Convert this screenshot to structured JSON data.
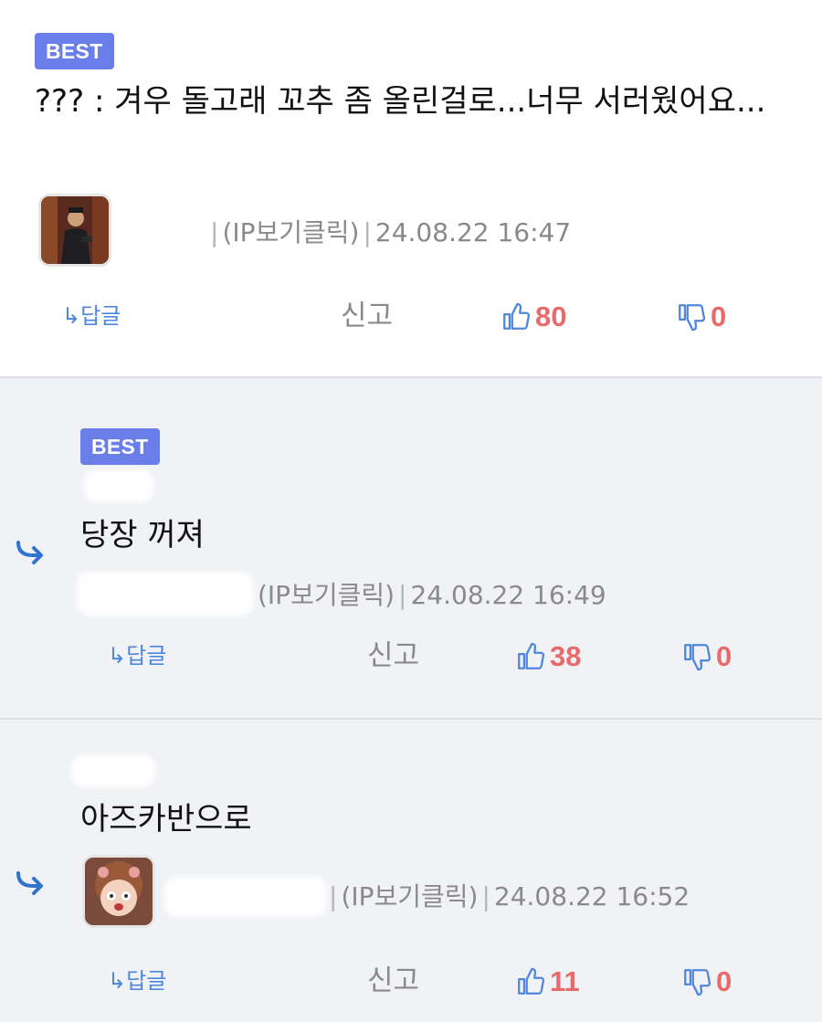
{
  "comments": [
    {
      "badge": "BEST",
      "text": "??? : 겨우 돌고래 꼬추 좀 올린걸로...너무 서러웠어요...",
      "ip": "(IP보기클릭)",
      "date": "24.08.22 16:47",
      "reply": "답글",
      "report": "신고",
      "likes": "80",
      "dislikes": "0"
    },
    {
      "badge": "BEST",
      "text": "당장 꺼져",
      "ip": "(IP보기클릭)",
      "date": "24.08.22 16:49",
      "reply": "답글",
      "report": "신고",
      "likes": "38",
      "dislikes": "0"
    },
    {
      "text": "아즈카반으로",
      "ip": "(IP보기클릭)",
      "date": "24.08.22 16:52",
      "reply": "답글",
      "report": "신고",
      "likes": "11",
      "dislikes": "0"
    }
  ],
  "colors": {
    "best_badge": "#6a7ee9",
    "accent_blue": "#4d86dc",
    "like_count": "#e96a6a"
  }
}
